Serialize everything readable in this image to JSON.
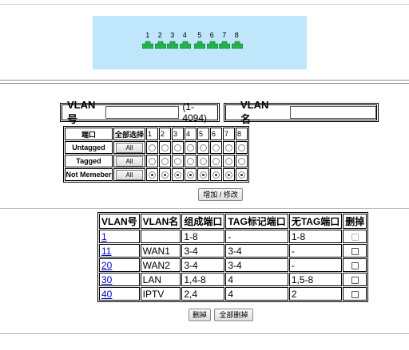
{
  "port_panel": {
    "ports": [
      "1",
      "2",
      "3",
      "4",
      "5",
      "6",
      "7",
      "8"
    ],
    "port_color": "#22b14c",
    "panel_color": "#bfe6fb"
  },
  "form": {
    "vlan_id_label": "VLAN号",
    "vlan_id_value": "",
    "vlan_id_range": "(1-4094)",
    "vlan_name_label": "VLAN名",
    "vlan_name_value": ""
  },
  "port_table": {
    "header_label": "端口",
    "select_all_label": "全部选择",
    "ports": [
      "1",
      "2",
      "3",
      "4",
      "5",
      "6",
      "7",
      "8"
    ],
    "all_button": "All",
    "rows": [
      {
        "label": "Untagged",
        "selected": []
      },
      {
        "label": "Tagged",
        "selected": []
      },
      {
        "label": "Not Memeber",
        "selected": [
          "1",
          "2",
          "3",
          "4",
          "5",
          "6",
          "7",
          "8"
        ]
      }
    ]
  },
  "buttons": {
    "add_modify": "增加 / 修改",
    "delete": "删掉",
    "delete_all": "全部删掉"
  },
  "vlan_list": {
    "headers": [
      "VLAN号",
      "VLAN名",
      "组成端口",
      "TAG标记端口",
      "无TAG端口",
      "删掉"
    ],
    "rows": [
      {
        "id": "1",
        "name": "",
        "ports": "1-8",
        "tagged": "-",
        "untagged": "1-8",
        "deletable": false
      },
      {
        "id": "11",
        "name": "WAN1",
        "ports": "3-4",
        "tagged": "3-4",
        "untagged": "-",
        "deletable": true
      },
      {
        "id": "20",
        "name": "WAN2",
        "ports": "3-4",
        "tagged": "3-4",
        "untagged": "-",
        "deletable": true
      },
      {
        "id": "30",
        "name": "LAN",
        "ports": "1,4-8",
        "tagged": "4",
        "untagged": "1,5-8",
        "deletable": true
      },
      {
        "id": "40",
        "name": "IPTV",
        "ports": "2,4",
        "tagged": "4",
        "untagged": "2",
        "deletable": true
      }
    ]
  }
}
